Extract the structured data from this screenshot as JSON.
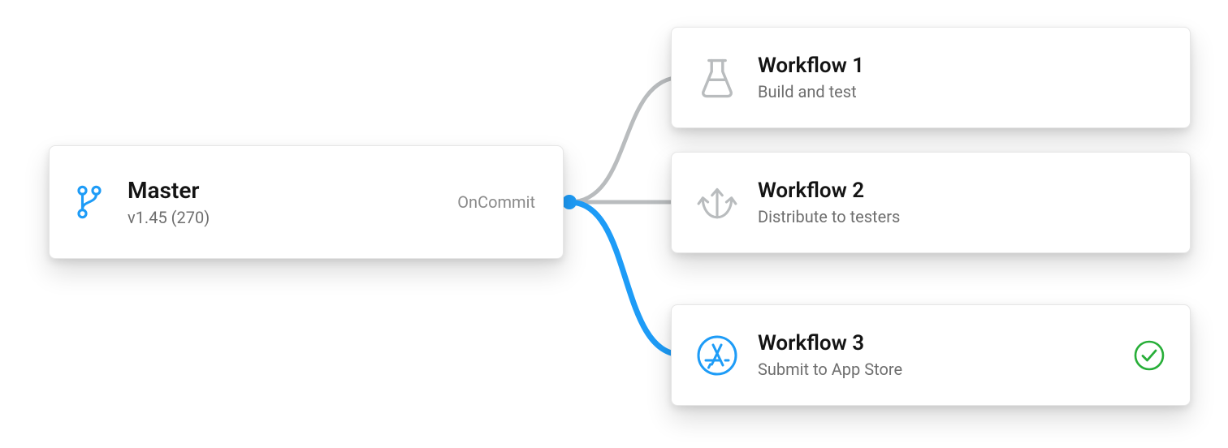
{
  "source": {
    "title": "Master",
    "subtitle": "v1.45 (270)",
    "trigger": "OnCommit"
  },
  "workflows": [
    {
      "title": "Workflow 1",
      "subtitle": "Build and test",
      "icon": "flask",
      "active": false,
      "status": "none"
    },
    {
      "title": "Workflow 2",
      "subtitle": "Distribute to testers",
      "icon": "distribute",
      "active": false,
      "status": "none"
    },
    {
      "title": "Workflow 3",
      "subtitle": "Submit to App Store",
      "icon": "appstore",
      "active": true,
      "status": "success"
    }
  ],
  "colors": {
    "blue": "#1E9CF7",
    "grey": "#B9BCBE",
    "green": "#27AE38"
  }
}
